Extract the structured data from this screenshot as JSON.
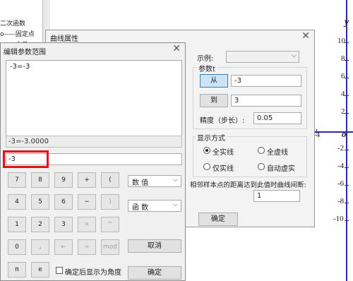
{
  "background": {
    "tree_items": [
      "二次函数",
      "o-----固定点",
      "v......中旦....."
    ]
  },
  "graph": {
    "y_label": "y",
    "x_label": "o",
    "x_tick": "-4",
    "y_ticks": [
      "10",
      "8",
      "6",
      "4",
      "2",
      "-2",
      "-4",
      "-6",
      "-8",
      "-10"
    ]
  },
  "curve_dialog": {
    "title": "曲线属性",
    "close": "✕",
    "example_label": "示例:",
    "param_label": "参数t",
    "from_button": "从",
    "from_value": "-3",
    "to_button": "到",
    "to_value": "3",
    "precision_label": "精度（步长）:",
    "precision_value": "0.05",
    "display_group": "显示方式",
    "radio_solid": "全实线",
    "radio_dashed": "全虚线",
    "radio_real": "仅实线",
    "radio_auto": "自动虚实",
    "break_label": "相邻样本点的距离达到此值时曲线间断:",
    "break_value": "1",
    "ok_button": "确定"
  },
  "param_dialog": {
    "title": "编辑参数范围",
    "close": "✕",
    "editor_text": "-3=-3",
    "result_text": "-3=-3.0000",
    "input_text": "-3",
    "keys": {
      "k7": "7",
      "k8": "8",
      "k9": "9",
      "kplus": "+",
      "klparen": "(",
      "k4": "4",
      "k5": "5",
      "k6": "6",
      "kminus": "−",
      "krparen": ")",
      "k1": "1",
      "k2": "2",
      "k3": "3",
      "kmul": "×",
      "kpow": "^",
      "k0": "0",
      "kdot": ".",
      "kback": "←",
      "kdiv": "÷",
      "kmod": "mod",
      "kpi": "π",
      "ke": "e"
    },
    "select_value": "数 值",
    "select_func": "函 数",
    "cancel_button": "取消",
    "checkbox_label": "确定后显示为角度",
    "ok_button": "确定"
  }
}
